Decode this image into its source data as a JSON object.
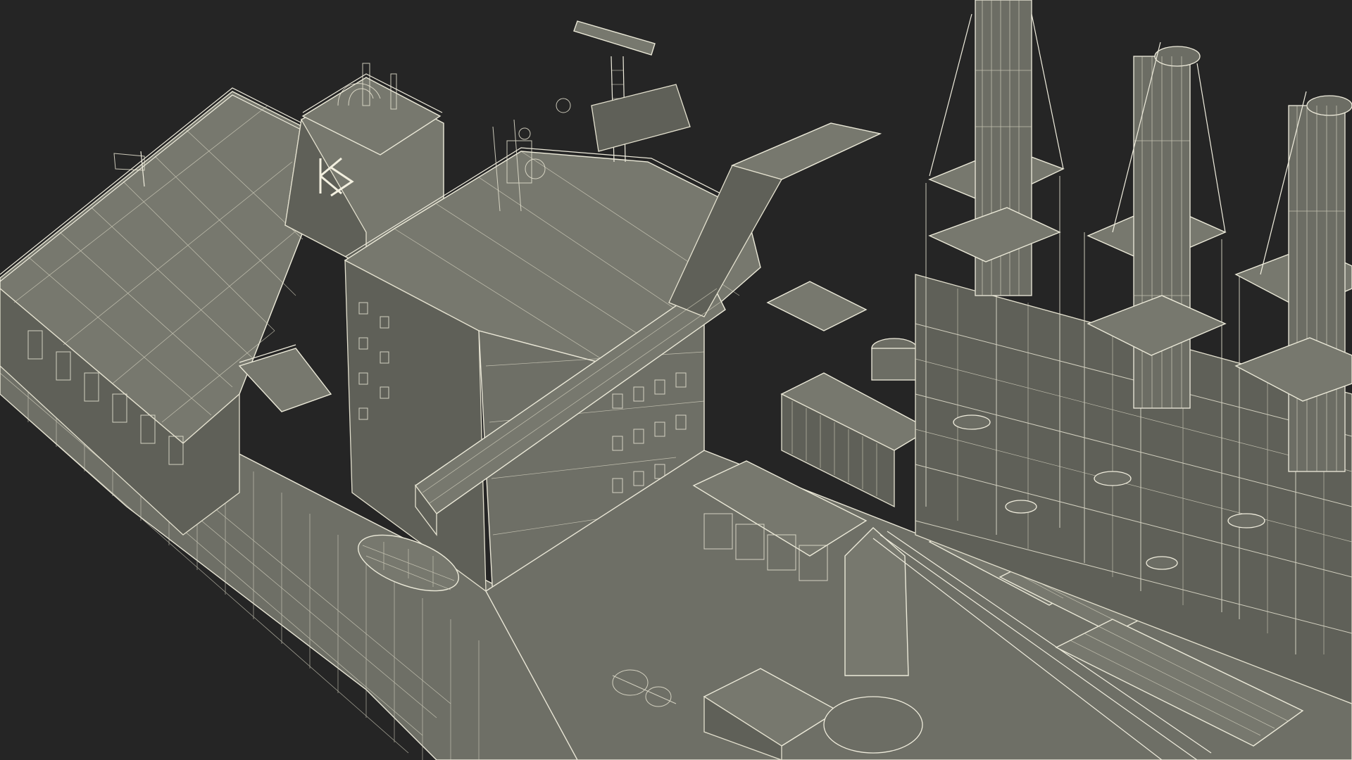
{
  "scene": {
    "background_color": "#252525",
    "model_fill": "#74756b",
    "wire_color": "#ebe8d8"
  },
  "funnel_logo": {
    "letter": "K"
  }
}
